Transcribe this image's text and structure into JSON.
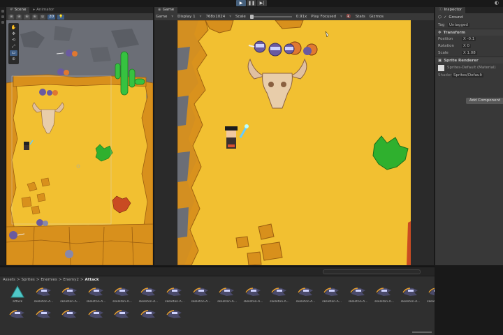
{
  "toolbar": {
    "play_icon": "▶",
    "pause_icon": "❚❚",
    "step_icon": "▶|",
    "layout_icon": "◐"
  },
  "scene": {
    "tabs": [
      "Scene",
      "Animator"
    ],
    "toolbar_buttons": [
      "⊞",
      "⊞",
      "⊞",
      "⊞",
      "◎",
      "2D",
      "💡"
    ],
    "tools": [
      "✋",
      "✥",
      "⟲",
      "⤢",
      "▭",
      "⊕"
    ]
  },
  "game": {
    "tab": "Game",
    "mode": "Game",
    "display": "Display 1",
    "resolution": "768x1024",
    "scale_label": "Scale",
    "scale_value": "0.91x",
    "play_focused": "Play Focused",
    "stats": "Stats",
    "gizmos": "Gizmos"
  },
  "inspector": {
    "tab": "Inspector",
    "object_name": "Ground",
    "tag_label": "Tag",
    "tag_value": "Untagged",
    "transform": "Transform",
    "position_label": "Position",
    "position_x": "X  -0.1",
    "rotation_label": "Rotation",
    "rotation_x": "X  0",
    "scale_label": "Scale",
    "scale_x": "X  1.08",
    "sprite_renderer": "Sprite Renderer",
    "material_value": "Sprites-Default (Material)",
    "shader_label": "Shader",
    "shader_value": "Sprites/Default",
    "add_component": "Add Component"
  },
  "project": {
    "breadcrumb": [
      "Assets",
      "Sprites",
      "Enemies",
      "Enemy2"
    ],
    "breadcrumb_current": "Attack",
    "assets": [
      "attack",
      "skeleton-A...",
      "skeleton-A...",
      "skeleton-A...",
      "skeleton-A...",
      "skeleton-A...",
      "skeleton-A...",
      "skeleton-A...",
      "skeleton-A...",
      "skeleton-A...",
      "skeleton-A...",
      "skeleton-A...",
      "skeleton-A...",
      "skeleton-A...",
      "skeleton-A...",
      "skeleton-A...",
      "skeleton-A..."
    ],
    "second_row_count": 7
  },
  "colors": {
    "sand": "#f2c031",
    "rock": "#d8901c",
    "cliff": "#6b6e76",
    "cactus": "#36c240",
    "bush": "#2fb02e",
    "accent": "#3d5c84"
  }
}
